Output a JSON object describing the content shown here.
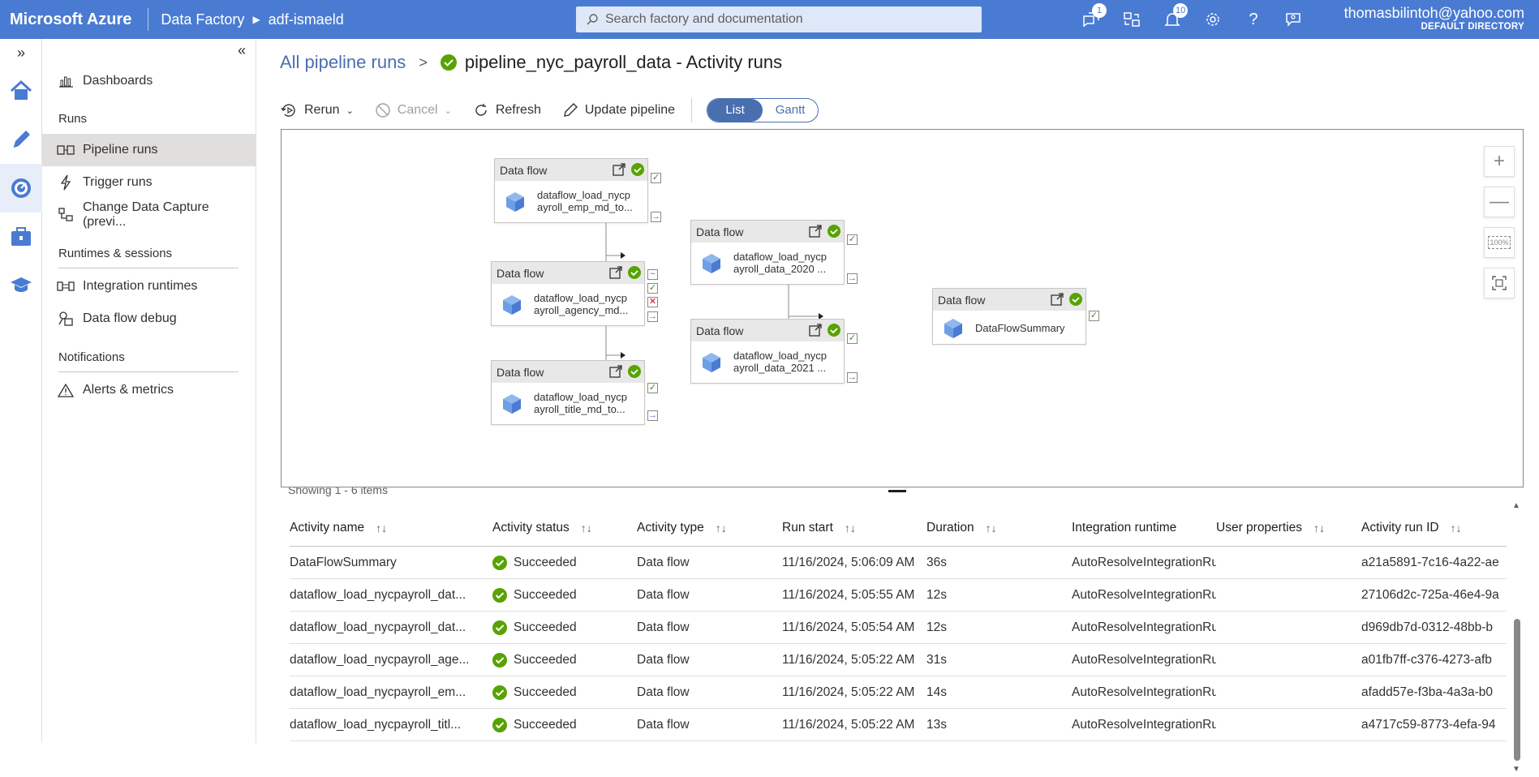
{
  "topbar": {
    "brand": "Microsoft Azure",
    "crumbs": [
      "Data Factory",
      "adf-ismaeld"
    ],
    "search_placeholder": "Search factory and documentation",
    "icons": [
      {
        "name": "feedback-icon",
        "badge": "1"
      },
      {
        "name": "switch-directory-icon",
        "badge": ""
      },
      {
        "name": "notifications-icon",
        "badge": "10"
      },
      {
        "name": "settings-icon",
        "badge": ""
      },
      {
        "name": "help-icon",
        "badge": ""
      },
      {
        "name": "support-icon",
        "badge": ""
      }
    ],
    "user_email": "thomasbilintoh@yahoo.com",
    "user_directory": "DEFAULT DIRECTORY"
  },
  "rail": {
    "expand_glyph": "»",
    "items": [
      "home-icon",
      "author-icon",
      "monitor-icon",
      "manage-icon",
      "learning-icon"
    ]
  },
  "sidenav": {
    "collapse_glyph": "«",
    "dashboards": "Dashboards",
    "runs_heading": "Runs",
    "pipeline_runs": "Pipeline runs",
    "trigger_runs": "Trigger runs",
    "cdc": "Change Data Capture (previ...",
    "runtimes_heading": "Runtimes & sessions",
    "integration_runtimes": "Integration runtimes",
    "dataflow_debug": "Data flow debug",
    "notifications_heading": "Notifications",
    "alerts": "Alerts & metrics"
  },
  "header": {
    "all_runs": "All pipeline runs",
    "sep": ">",
    "pipeline_title": "pipeline_nyc_payroll_data - Activity runs"
  },
  "toolbar": {
    "rerun": "Rerun",
    "cancel": "Cancel",
    "refresh": "Refresh",
    "update_pipeline": "Update pipeline",
    "view_list": "List",
    "view_gantt": "Gantt"
  },
  "canvas": {
    "nodes": [
      {
        "type": "Data flow",
        "name": "dataflow_load_nycp\nayroll_emp_md_to..."
      },
      {
        "type": "Data flow",
        "name": "dataflow_load_nycp\nayroll_agency_md..."
      },
      {
        "type": "Data flow",
        "name": "dataflow_load_nycp\nayroll_title_md_to..."
      },
      {
        "type": "Data flow",
        "name": "dataflow_load_nycp\nayroll_data_2020 ..."
      },
      {
        "type": "Data flow",
        "name": "dataflow_load_nycp\nayroll_data_2021 ..."
      },
      {
        "type": "Data flow",
        "name": "DataFlowSummary"
      }
    ],
    "zoom_fit_label": "100%"
  },
  "table": {
    "showing": "Showing 1 - 6 items",
    "columns": [
      "Activity name",
      "Activity status",
      "Activity type",
      "Run start",
      "Duration",
      "Integration runtime",
      "User properties",
      "Activity run ID"
    ],
    "rows": [
      [
        "DataFlowSummary",
        "Succeeded",
        "Data flow",
        "11/16/2024, 5:06:09 AM",
        "36s",
        "AutoResolveIntegrationRuntime",
        "",
        "a21a5891-7c16-4a22-ae"
      ],
      [
        "dataflow_load_nycpayroll_dat...",
        "Succeeded",
        "Data flow",
        "11/16/2024, 5:05:55 AM",
        "12s",
        "AutoResolveIntegrationRuntime",
        "",
        "27106d2c-725a-46e4-9a"
      ],
      [
        "dataflow_load_nycpayroll_dat...",
        "Succeeded",
        "Data flow",
        "11/16/2024, 5:05:54 AM",
        "12s",
        "AutoResolveIntegrationRuntime",
        "",
        "d969db7d-0312-48bb-b"
      ],
      [
        "dataflow_load_nycpayroll_age...",
        "Succeeded",
        "Data flow",
        "11/16/2024, 5:05:22 AM",
        "31s",
        "AutoResolveIntegrationRuntime",
        "",
        "a01fb7ff-c376-4273-afb"
      ],
      [
        "dataflow_load_nycpayroll_em...",
        "Succeeded",
        "Data flow",
        "11/16/2024, 5:05:22 AM",
        "14s",
        "AutoResolveIntegrationRuntime",
        "",
        "afadd57e-f3ba-4a3a-b0"
      ],
      [
        "dataflow_load_nycpayroll_titl...",
        "Succeeded",
        "Data flow",
        "11/16/2024, 5:05:22 AM",
        "13s",
        "AutoResolveIntegrationRuntime",
        "",
        "a4717c59-8773-4efa-94"
      ]
    ]
  },
  "colors": {
    "accent": "#4a7bd3",
    "success": "#57a300",
    "link": "#4a6fb0"
  }
}
